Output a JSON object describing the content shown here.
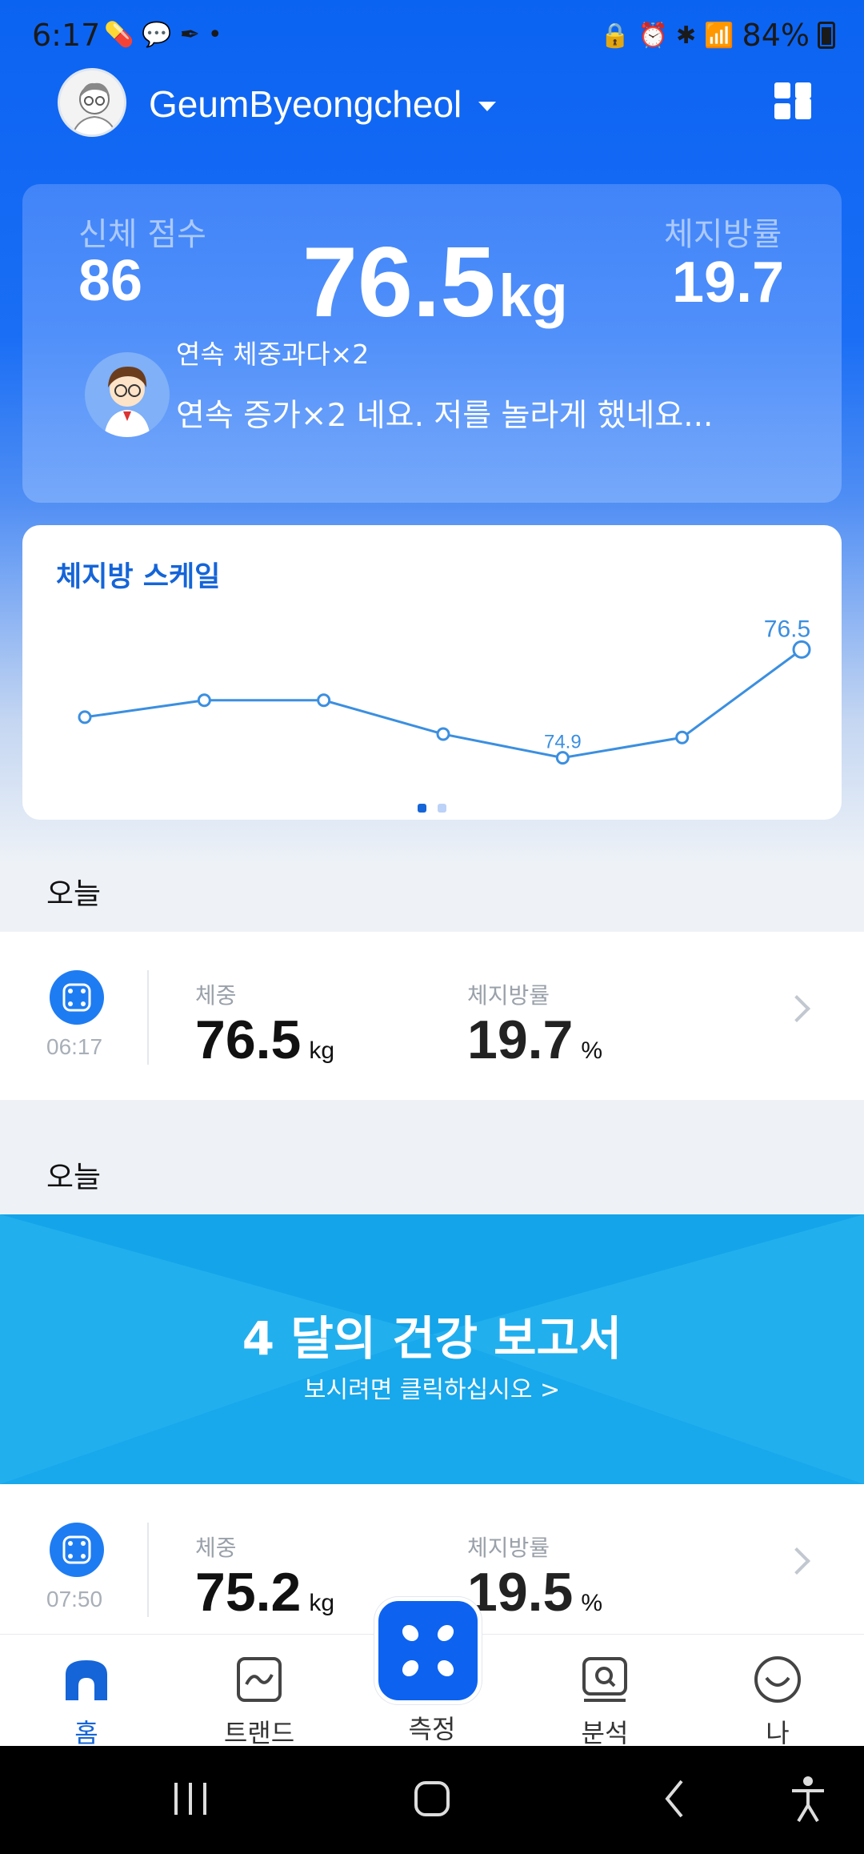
{
  "status_bar": {
    "time": "6:17",
    "battery": "84%",
    "left_icons": [
      "pill-icon",
      "talk-icon",
      "pen-icon",
      "dot-icon"
    ],
    "right_icons": [
      "lock-icon",
      "alarm-icon",
      "bluetooth-icon",
      "wifi-icon",
      "hd-voice-icon",
      "signal-icon",
      "battery-icon"
    ]
  },
  "header": {
    "username": "GeumByeongcheol"
  },
  "score_card": {
    "body_score_label": "신체 점수",
    "body_score_value": "86",
    "weight_value": "76.5",
    "weight_unit": "kg",
    "body_fat_label": "체지방률",
    "body_fat_value": "19.7",
    "message_title": "연속 체중과다×2",
    "message_body": "연속 증가×2 네요. 저를 놀라게 했네요..."
  },
  "chart_card": {
    "title": "체지방 스케일",
    "page_count": 2,
    "active_page": 1
  },
  "chart_data": {
    "type": "line",
    "title": "체지방 스케일",
    "values": [
      75.5,
      75.75,
      75.75,
      75.25,
      74.9,
      75.2,
      76.5
    ],
    "point_labels": [
      "",
      "",
      "",
      "",
      "74.9",
      "",
      "76.5"
    ],
    "ylim": [
      74.6,
      76.8
    ],
    "grid": false,
    "color": "#3b8fe0"
  },
  "sections": [
    {
      "label": "오늘"
    },
    {
      "label": "오늘"
    }
  ],
  "records": [
    {
      "time": "06:17",
      "weight_label": "체중",
      "weight_value": "76.5",
      "weight_unit": "kg",
      "fat_label": "체지방률",
      "fat_value": "19.7",
      "fat_unit": "%"
    },
    {
      "time": "07:50",
      "weight_label": "체중",
      "weight_value": "75.2",
      "weight_unit": "kg",
      "fat_label": "체지방률",
      "fat_value": "19.5",
      "fat_unit": "%"
    }
  ],
  "banner": {
    "title": "4 달의 건강 보고서",
    "subtitle": "보시려면 클릭하십시오 >"
  },
  "bottom_nav": {
    "items": [
      {
        "label": "홈",
        "icon": "home-icon",
        "active": true
      },
      {
        "label": "트랜드",
        "icon": "trend-icon",
        "active": false
      },
      {
        "label": "측정",
        "icon": "measure-icon",
        "active": false
      },
      {
        "label": "분석",
        "icon": "analysis-icon",
        "active": false
      },
      {
        "label": "나",
        "icon": "me-icon",
        "active": false
      }
    ]
  },
  "colors": {
    "brand": "#0d63f0",
    "accent": "#1565d8",
    "banner": "#18a8ec"
  }
}
